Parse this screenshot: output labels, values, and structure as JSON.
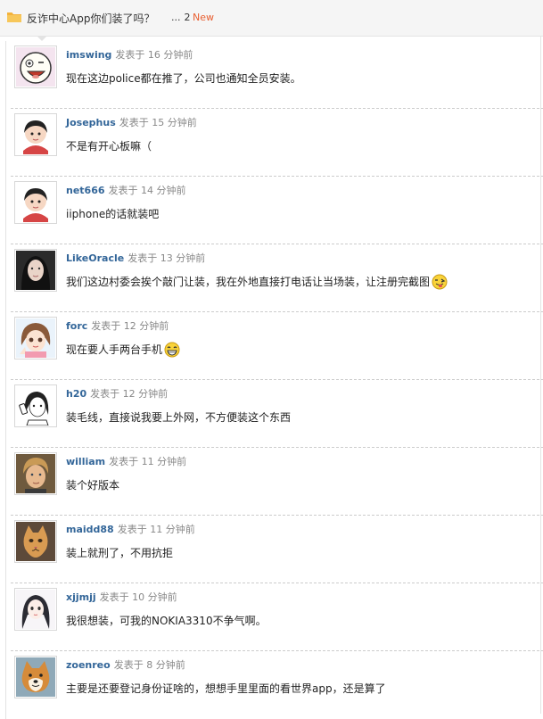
{
  "header": {
    "title": "反诈中心App你们装了吗？",
    "ellipsis": "...",
    "page": "2",
    "new_label": "New"
  },
  "posts": [
    {
      "user": "imswing",
      "time": "发表于 16 分钟前",
      "text": "现在这边police都在推了，公司也通知全员安装。",
      "avatar": "cartoon-face-avatar"
    },
    {
      "user": "Josephus",
      "time": "发表于 15 分钟前",
      "text": "不是有开心板嘛（",
      "avatar": "cartoon-girl-avatar"
    },
    {
      "user": "net666",
      "time": "发表于 14 分钟前",
      "text": "iiphone的话就装吧",
      "avatar": "cartoon-girl-avatar"
    },
    {
      "user": "LikeOracle",
      "time": "发表于 13 分钟前",
      "text": "我们这边村委会挨个敲门让装，我在外地直接打电话让当场装，让注册完截图",
      "avatar": "photo-woman-avatar",
      "emoji": "wink-tongue-emoji"
    },
    {
      "user": "forc",
      "time": "发表于 12 分钟前",
      "text": "现在要人手两台手机",
      "avatar": "anime-girl-avatar",
      "emoji": "grin-emoji"
    },
    {
      "user": "h20",
      "time": "发表于 12 分钟前",
      "text": "装毛线，直接说我要上外网，不方便装这个东西",
      "avatar": "sketch-girl-phone-avatar"
    },
    {
      "user": "william",
      "time": "发表于 11 分钟前",
      "text": "装个好版本",
      "avatar": "photo-man-avatar"
    },
    {
      "user": "maidd88",
      "time": "发表于 11 分钟前",
      "text": "装上就刑了，不用抗拒",
      "avatar": "cat-avatar"
    },
    {
      "user": "xjjmjj",
      "time": "发表于 10 分钟前",
      "text": "我很想装，可我的NOKIA3310不争气啊。",
      "avatar": "anime-woman-avatar"
    },
    {
      "user": "zoenreo",
      "time": "发表于 8 分钟前",
      "text": "主要是还要登记身份证啥的，想想手里里面的看世界app，还是算了",
      "avatar": "shiba-dog-avatar"
    }
  ],
  "colors": {
    "username": "#336699",
    "new_badge": "#e85e30",
    "meta": "#888888",
    "folder": "#f3b23b"
  }
}
